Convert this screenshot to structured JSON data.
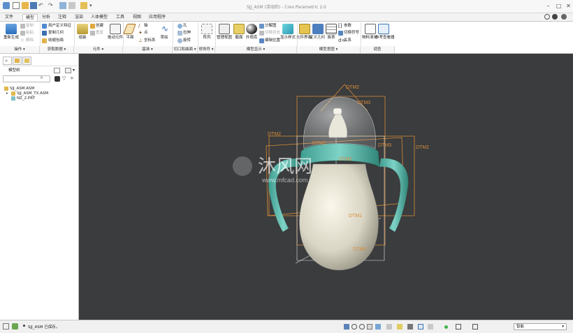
{
  "app": {
    "title": "SJJ_ASM (活动的) - Creo Parametric 2.0"
  },
  "tabs": [
    "文件",
    "模型",
    "分析",
    "注释",
    "渲染",
    "人体模型",
    "工具",
    "视图",
    "应用程序"
  ],
  "active_tab": "模型",
  "ribbon": {
    "regenerate": "重新生成",
    "copy": "复制",
    "paste": "粘贴",
    "delete": "删除",
    "user_defined_feature": "用户定义特征",
    "copy_geometry": "复制几何",
    "shrinkwrap": "收缩包络",
    "assemble": "组装",
    "create": "创建",
    "repeat": "重复",
    "drag_components": "拖动元件",
    "plane": "平面",
    "axis": "轴",
    "point": "点",
    "csys": "坐标系",
    "sketch": "草绘",
    "hole": "孔",
    "extrude": "拉伸",
    "revolve": "旋转",
    "pattern": "阵列",
    "manage_views": "管理视图",
    "section": "截面",
    "appearance_gallery": "外观库",
    "exploded_view": "分解图",
    "toggle_status": "切换状态",
    "edit_position": "编辑位置",
    "display_style": "显示样式",
    "component_interface": "元件界面",
    "mechanism_connection": "定义几何",
    "family_table": "族表",
    "parameters": "参数",
    "switch_symbols": "切换符号",
    "relations": "关系",
    "bill_of_materials": "物料清单",
    "reference_viewer": "参考查看器",
    "groups": {
      "operations": "操作",
      "get_data": "获取数据",
      "component": "元件",
      "datum": "基准",
      "cut_surface": "切口和曲面",
      "modifiers": "修饰符",
      "model_display": "模型显示",
      "model_intent": "模型意图",
      "investigate": "调查"
    }
  },
  "model_tree": {
    "title": "模型树",
    "items": [
      "SJJ_ASM.ASM",
      "SJJ_ASM_TX.ASM",
      "NZ_2.PRT"
    ]
  },
  "viewport": {
    "datum_labels": [
      "DTM2",
      "DTM3",
      "DTM2",
      "DTM2",
      "DTM3",
      "DTM1",
      "DTM1",
      "DTM3",
      "DTM1"
    ],
    "watermark": "沐风网",
    "watermark_url": "www.mfcad.com"
  },
  "status": {
    "message": "SJJ_ASM 已保存。",
    "filter": "智能"
  },
  "colors": {
    "accent": "#2a74c9",
    "viewport_bg": "#3a3c3d",
    "datum_orange": "#d98c3c",
    "handle_teal": "#52b8a9"
  }
}
